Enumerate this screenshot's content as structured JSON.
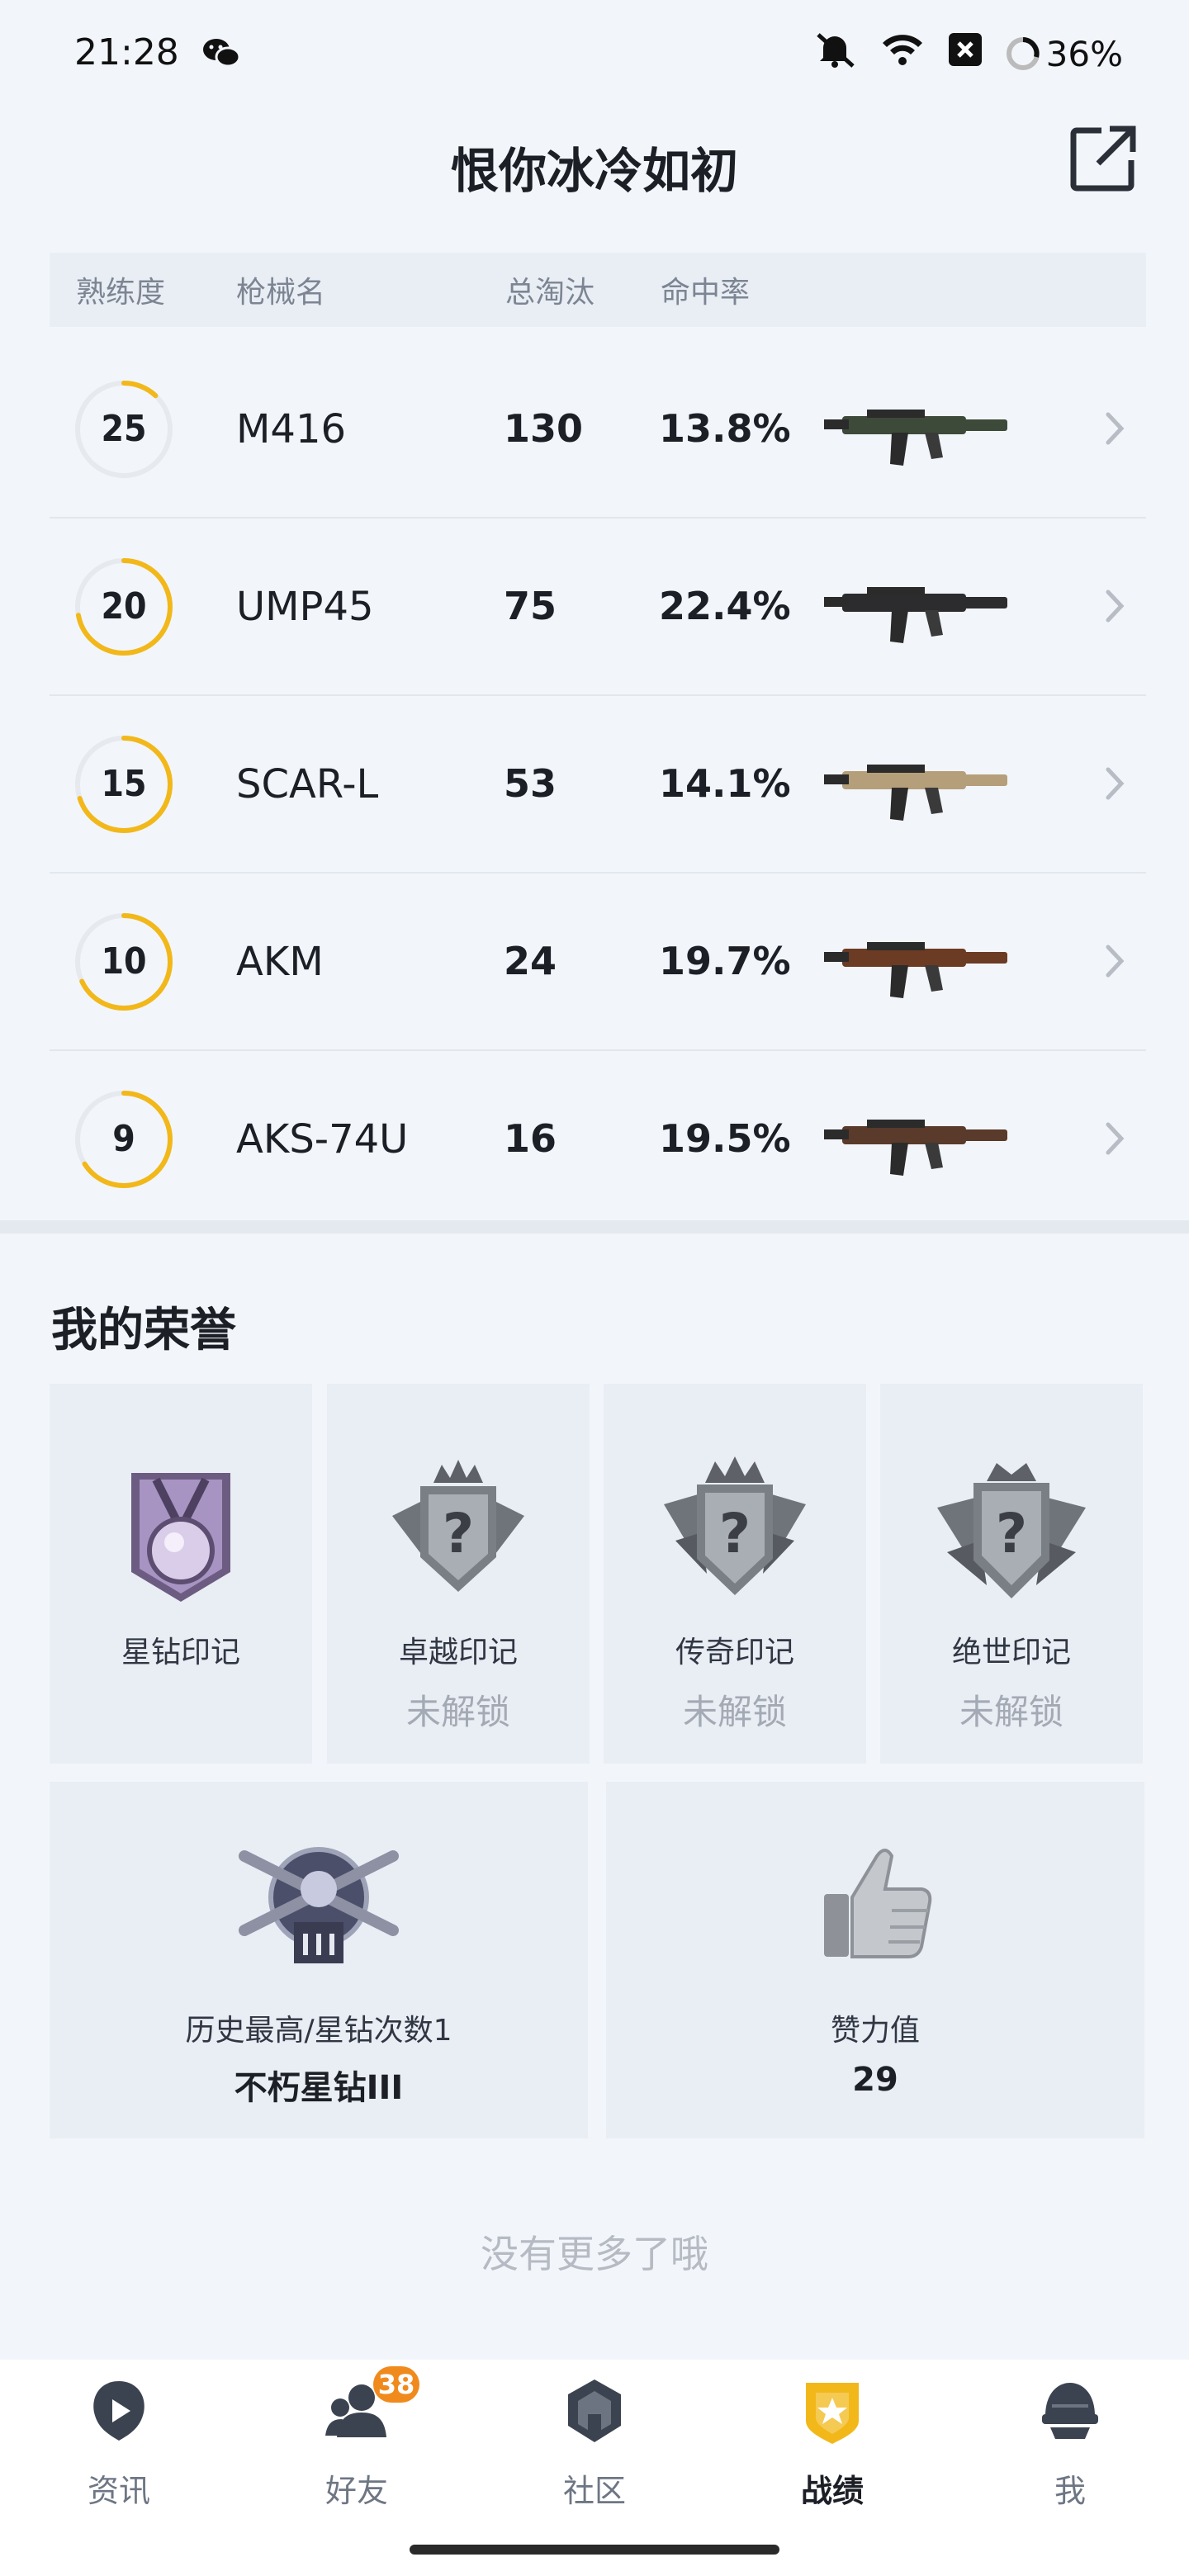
{
  "status_bar": {
    "time": "21:28",
    "battery": "36%"
  },
  "header": {
    "title": "恨你冰冷如初"
  },
  "weapons_table": {
    "columns": [
      "熟练度",
      "枪械名",
      "总淘汰",
      "命中率"
    ],
    "rows": [
      {
        "mastery": "25",
        "name": "M416",
        "kills": "130",
        "hit_rate": "13.8%",
        "progress": 0.12
      },
      {
        "mastery": "20",
        "name": "UMP45",
        "kills": "75",
        "hit_rate": "22.4%",
        "progress": 0.72
      },
      {
        "mastery": "15",
        "name": "SCAR-L",
        "kills": "53",
        "hit_rate": "14.1%",
        "progress": 0.7
      },
      {
        "mastery": "10",
        "name": "AKM",
        "kills": "24",
        "hit_rate": "19.7%",
        "progress": 0.68
      },
      {
        "mastery": "9",
        "name": "AKS-74U",
        "kills": "16",
        "hit_rate": "19.5%",
        "progress": 0.66
      }
    ]
  },
  "honors": {
    "title": "我的荣誉",
    "marks": [
      {
        "name": "星钻印记",
        "status": ""
      },
      {
        "name": "卓越印记",
        "status": "未解锁"
      },
      {
        "name": "传奇印记",
        "status": "未解锁"
      },
      {
        "name": "绝世印记",
        "status": "未解锁"
      }
    ],
    "best": {
      "label": "历史最高/星钻次数1",
      "value": "不朽星钻III"
    },
    "likes": {
      "label": "赞力值",
      "value": "29"
    }
  },
  "footer_note": "没有更多了哦",
  "bottom_nav": {
    "items": [
      {
        "label": "资讯"
      },
      {
        "label": "好友",
        "badge": "38"
      },
      {
        "label": "社区"
      },
      {
        "label": "战绩"
      },
      {
        "label": "我"
      }
    ]
  },
  "colors": {
    "accent": "#f2b81a",
    "ring_track": "#e6e9ee",
    "badge": "#f08a1d",
    "background": "#f2f6fb"
  }
}
